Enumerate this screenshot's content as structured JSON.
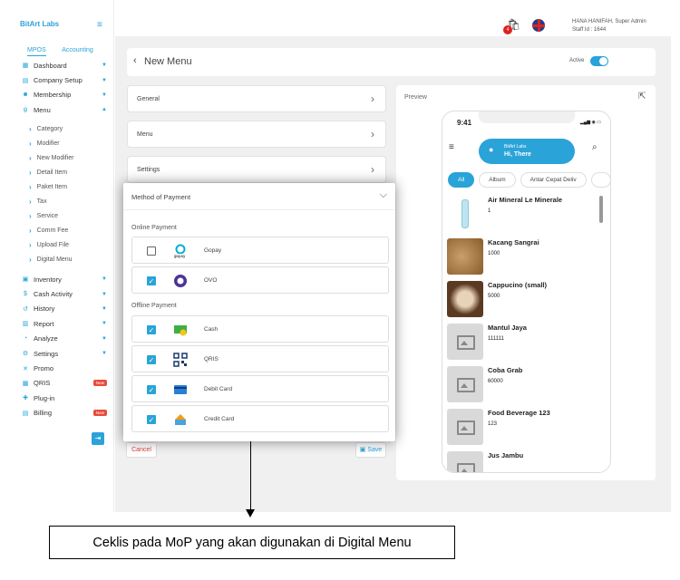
{
  "brand": "BitArt Labs",
  "sidebar_tabs": [
    "MPOS",
    "Accounting"
  ],
  "nav_top": [
    {
      "icon": "dashboard-icon",
      "label": "Dashboard"
    },
    {
      "icon": "company-icon",
      "label": "Company Setup"
    },
    {
      "icon": "membership-icon",
      "label": "Membership"
    },
    {
      "icon": "menu-icon",
      "label": "Menu"
    }
  ],
  "menu_sub": [
    "Category",
    "Modifier",
    "New Modifier",
    "Detail Item",
    "Paket Item",
    "Tax",
    "Service",
    "Comm Fee",
    "Upload File",
    "Digital Menu"
  ],
  "nav_bottom": [
    {
      "icon": "inventory-icon",
      "label": "Inventory",
      "caret": true
    },
    {
      "icon": "cash-icon",
      "label": "Cash Activity",
      "caret": true
    },
    {
      "icon": "history-icon",
      "label": "History",
      "caret": true
    },
    {
      "icon": "report-icon",
      "label": "Report",
      "caret": true
    },
    {
      "icon": "analyze-icon",
      "label": "Analyze",
      "caret": true
    },
    {
      "icon": "settings-icon",
      "label": "Settings",
      "caret": true
    },
    {
      "icon": "promo-icon",
      "label": "Promo",
      "caret": false
    },
    {
      "icon": "qris-icon",
      "label": "QRIS",
      "caret": false,
      "badge": "New"
    },
    {
      "icon": "plugin-icon",
      "label": "Plug-in",
      "caret": false
    },
    {
      "icon": "billing-icon",
      "label": "Billing",
      "caret": false,
      "badge": "New"
    }
  ],
  "topbar": {
    "cart_count": "4",
    "user_name": "HANA HANIFAH, Super Admin",
    "staff_id": "Staff Id : 1644"
  },
  "page": {
    "title": "New Menu",
    "active_label": "Active",
    "active": true
  },
  "sections": [
    "General",
    "Menu",
    "Settings"
  ],
  "buttons": {
    "cancel": "Cancel",
    "save": "Save"
  },
  "preview": {
    "label": "Preview",
    "time": "9:41",
    "greeting_brand": "BitArt Labs",
    "greeting": "Hi, There",
    "categories": [
      "All",
      "Album",
      "Antar Cepat Deliv"
    ],
    "products": [
      {
        "name": "Air Mineral Le Minerale",
        "price": "1",
        "img": "bottle"
      },
      {
        "name": "Kacang Sangrai",
        "price": "1000",
        "img": "nuts"
      },
      {
        "name": "Cappucino (small)",
        "price": "5000",
        "img": "coffee"
      },
      {
        "name": "Mantul Jaya",
        "price": "111111",
        "img": "placeholder"
      },
      {
        "name": "Coba Grab",
        "price": "60000",
        "img": "placeholder"
      },
      {
        "name": "Food Beverage 123",
        "price": "123",
        "img": "placeholder"
      },
      {
        "name": "Jus Jambu",
        "price": "",
        "img": "placeholder"
      }
    ]
  },
  "payment": {
    "title": "Method of Payment",
    "online_label": "Online Payment",
    "online": [
      {
        "label": "Gopay",
        "checked": false
      },
      {
        "label": "OVO",
        "checked": true
      }
    ],
    "offline_label": "Offline Payment",
    "offline": [
      {
        "label": "Cash",
        "checked": true
      },
      {
        "label": "QRIS",
        "checked": true
      },
      {
        "label": "Debit Card",
        "checked": true
      },
      {
        "label": "Credit Card",
        "checked": true
      }
    ]
  },
  "callout": "Ceklis pada MoP yang akan digunakan di Digital Menu",
  "colors": {
    "accent": "#2aa3d8",
    "danger": "#e04040"
  }
}
